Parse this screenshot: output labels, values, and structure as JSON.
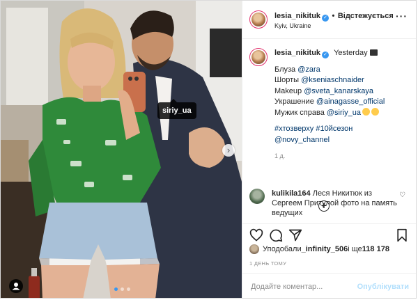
{
  "photo": {
    "tag_label": "siriy_ua",
    "carousel": {
      "count": 3,
      "active_index": 0
    }
  },
  "header": {
    "username": "lesia_nikituk",
    "verified": true,
    "separator": "•",
    "follow_state": "Відстежується",
    "location": "Kyiv, Ukraine",
    "more_icon": "ellipsis-icon"
  },
  "caption": {
    "username": "lesia_nikituk",
    "time": "Yesterday",
    "lines": [
      {
        "label": "Блуза ",
        "mention": "@zara"
      },
      {
        "label": "Шорты ",
        "mention": "@kseniaschnaider"
      },
      {
        "label": "Makeup ",
        "mention": "@sveta_kanarskaya"
      },
      {
        "label": "Украшение ",
        "mention": "@ainagasse_official"
      },
      {
        "label": "Мужик справа ",
        "mention": "@siriy_ua"
      }
    ],
    "hashtags": [
      "#хтозверху",
      "#10йсезон",
      "@novy_channel"
    ],
    "age": "1 д."
  },
  "comment": {
    "username": "kulikila164",
    "text": "Леся Никитюк из Сергеем Притулой фото на память ведущих"
  },
  "actions": {
    "icons": [
      "heart-icon",
      "comment-icon",
      "share-icon",
      "bookmark-icon"
    ]
  },
  "likes": {
    "prefix": "Уподобали ",
    "user": "_infinity_506",
    "middle": " і ще ",
    "count": "118 178"
  },
  "post_age": "1 ДЕНЬ ТОМУ",
  "comment_box": {
    "placeholder": "Додайте коментар...",
    "post_label": "Опублікувати"
  },
  "colors": {
    "link": "#00376b",
    "verified": "#3897f0",
    "post_disabled": "#b2dffc",
    "muted": "#8e8e8e"
  }
}
